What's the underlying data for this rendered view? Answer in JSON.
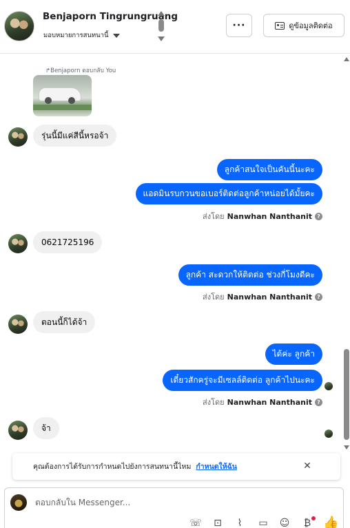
{
  "header": {
    "contact_name": "Benjaporn Tingrungruang",
    "assign_label": "มอบหมายการสนทนานี้",
    "more_label": "···",
    "contact_info_label": "ดูข้อมูลติดต่อ"
  },
  "conversation": {
    "reply_reference": "Benjaporn ตอบกลับ You",
    "messages": [
      {
        "text": "รุ่นนี้มีแค่สีนี้หรอจ้า"
      },
      {
        "text": "ลูกค้าสนใจเป็นคันนี้นะคะ"
      },
      {
        "text": "แอดมินรบกวนขอเบอร์ติดต่อลูกค้าหน่อยได้มั้ยคะ"
      },
      {
        "text": "0621725196"
      },
      {
        "text": "ลูกค้า สะดวกให้ติดต่อ ช่วงกี่โมงดีคะ"
      },
      {
        "text": "ตอนนี้ก็ได้จ้า"
      },
      {
        "text": "ได้ค่ะ  ลูกค้า"
      },
      {
        "text": "เดี๋ยวสักครู่จะมีเซลล์ติดต่อ ลูกค้าไปนะคะ"
      },
      {
        "text": "จ้า"
      }
    ],
    "sent_by_prefix": "ส่งโดย",
    "sent_by_name": "Nanwhan Nanthanit"
  },
  "notice": {
    "text": "คุณต้องการได้รับการกำหนดไปยังการสนทนานี้ไหม",
    "link": "กำหนดให้ฉัน",
    "close": "✕"
  },
  "composer": {
    "placeholder": "ตอบกลับใน Messenger..."
  },
  "colors": {
    "outgoing_bubble": "#0866ff",
    "incoming_bubble": "#f0f0f0",
    "link": "#0866ff",
    "notification_dot": "#e41e3f"
  }
}
